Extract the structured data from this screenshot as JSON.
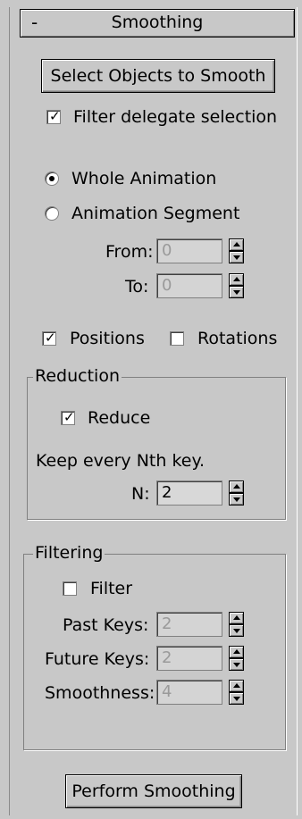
{
  "rollout": {
    "toggle_symbol": "-",
    "title": "Smoothing"
  },
  "buttons": {
    "select_objects": "Select Objects to Smooth",
    "perform": "Perform Smoothing"
  },
  "filter_delegate": {
    "label": "Filter delegate selection",
    "checked": true
  },
  "range": {
    "options": [
      {
        "label": "Whole Animation",
        "selected": true
      },
      {
        "label": "Animation Segment",
        "selected": false
      }
    ],
    "from": {
      "label": "From:",
      "value": "0"
    },
    "to": {
      "label": "To:",
      "value": "0"
    }
  },
  "channels": {
    "positions": {
      "label": "Positions",
      "checked": true
    },
    "rotations": {
      "label": "Rotations",
      "checked": false
    }
  },
  "reduction": {
    "title": "Reduction",
    "reduce": {
      "label": "Reduce",
      "checked": true
    },
    "hint": "Keep every Nth key.",
    "n": {
      "label": "N:",
      "value": "2"
    }
  },
  "filtering": {
    "title": "Filtering",
    "filter": {
      "label": "Filter",
      "checked": false
    },
    "past_keys": {
      "label": "Past Keys:",
      "value": "2"
    },
    "future_keys": {
      "label": "Future Keys:",
      "value": "2"
    },
    "smoothness": {
      "label": "Smoothness:",
      "value": "4"
    }
  }
}
